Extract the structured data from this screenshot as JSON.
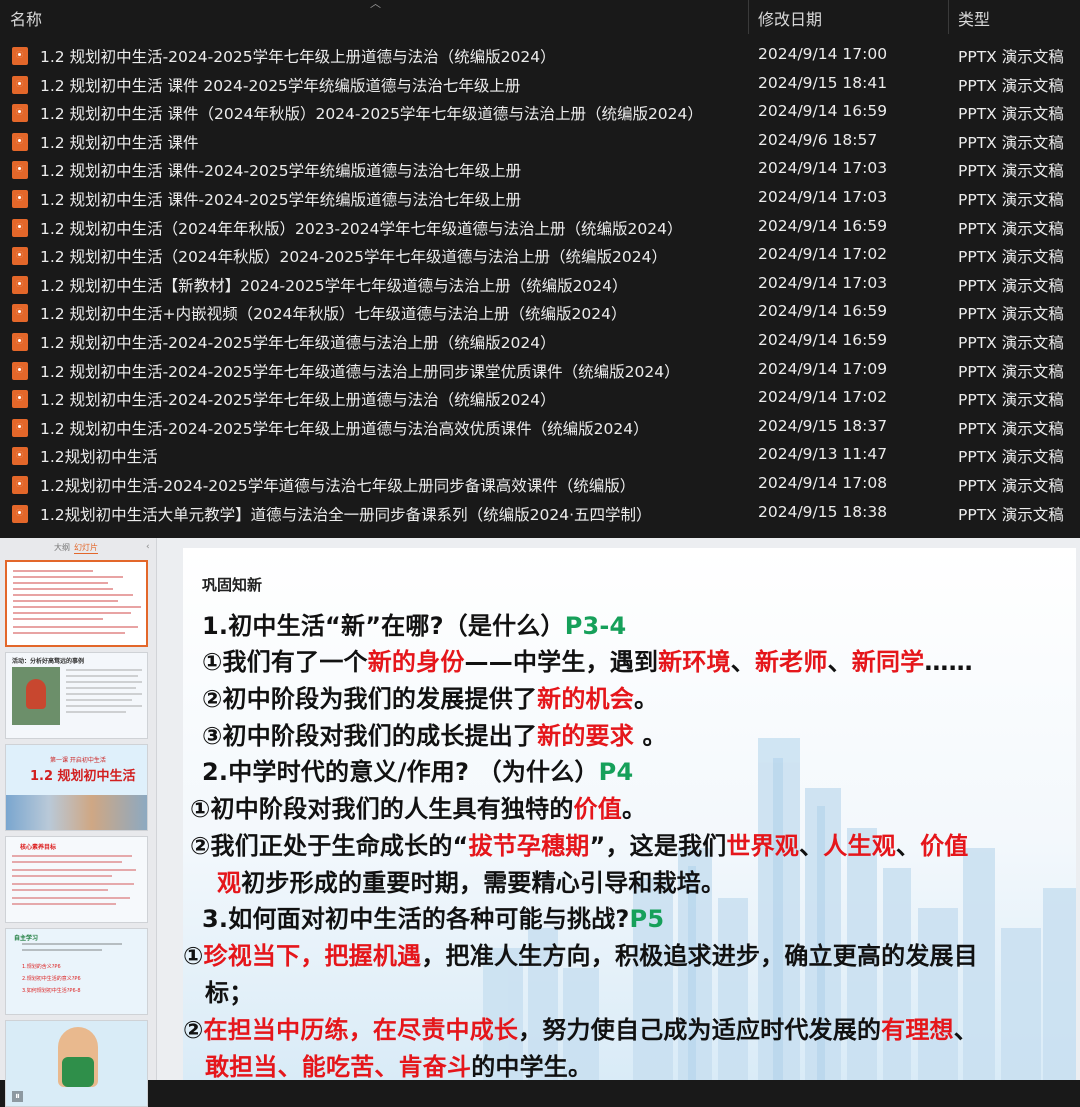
{
  "explorer": {
    "columns": {
      "name": "名称",
      "modified": "修改日期",
      "type": "类型"
    },
    "rows": [
      {
        "name": "1.2  规划初中生活-2024-2025学年七年级上册道德与法治（统编版2024）",
        "date": "2024/9/14 17:00",
        "type": "PPTX 演示文稿"
      },
      {
        "name": "1.2 规划初中生活 课件 2024-2025学年统编版道德与法治七年级上册",
        "date": "2024/9/15 18:41",
        "type": "PPTX 演示文稿"
      },
      {
        "name": "1.2 规划初中生活 课件（2024年秋版）2024-2025学年七年级道德与法治上册（统编版2024）",
        "date": "2024/9/14 16:59",
        "type": "PPTX 演示文稿"
      },
      {
        "name": "1.2 规划初中生活 课件",
        "date": "2024/9/6 18:57",
        "type": "PPTX 演示文稿"
      },
      {
        "name": "1.2 规划初中生活 课件-2024-2025学年统编版道德与法治七年级上册",
        "date": "2024/9/14 17:03",
        "type": "PPTX 演示文稿"
      },
      {
        "name": "1.2 规划初中生活 课件-2024-2025学年统编版道德与法治七年级上册",
        "date": "2024/9/14 17:03",
        "type": "PPTX 演示文稿"
      },
      {
        "name": "1.2 规划初中生活（2024年年秋版）2023-2024学年七年级道德与法治上册（统编版2024）",
        "date": "2024/9/14 16:59",
        "type": "PPTX 演示文稿"
      },
      {
        "name": "1.2 规划初中生活（2024年秋版）2024-2025学年七年级道德与法治上册（统编版2024）",
        "date": "2024/9/14 17:02",
        "type": "PPTX 演示文稿"
      },
      {
        "name": "1.2 规划初中生活【新教材】2024-2025学年七年级道德与法治上册（统编版2024）",
        "date": "2024/9/14 17:03",
        "type": "PPTX 演示文稿"
      },
      {
        "name": "1.2 规划初中生活+内嵌视频（2024年秋版）七年级道德与法治上册（统编版2024）",
        "date": "2024/9/14 16:59",
        "type": "PPTX 演示文稿"
      },
      {
        "name": "1.2 规划初中生活-2024-2025学年七年级道德与法治上册（统编版2024）",
        "date": "2024/9/14 16:59",
        "type": "PPTX 演示文稿"
      },
      {
        "name": "1.2 规划初中生活-2024-2025学年七年级道德与法治上册同步课堂优质课件（统编版2024）",
        "date": "2024/9/14 17:09",
        "type": "PPTX 演示文稿"
      },
      {
        "name": "1.2 规划初中生活-2024-2025学年七年级上册道德与法治（统编版2024）",
        "date": "2024/9/14 17:02",
        "type": "PPTX 演示文稿"
      },
      {
        "name": "1.2 规划初中生活-2024-2025学年七年级上册道德与法治高效优质课件（统编版2024）",
        "date": "2024/9/15 18:37",
        "type": "PPTX 演示文稿"
      },
      {
        "name": "1.2规划初中生活",
        "date": "2024/9/13 11:47",
        "type": "PPTX 演示文稿"
      },
      {
        "name": "1.2规划初中生活-2024-2025学年道德与法治七年级上册同步备课高效课件（统编版）",
        "date": "2024/9/14 17:08",
        "type": "PPTX 演示文稿"
      },
      {
        "name": "1.2规划初中生活大单元教学】道德与法治全一册同步备课系列（统编版2024·五四学制）",
        "date": "2024/9/15 18:38",
        "type": "PPTX 演示文稿"
      }
    ]
  },
  "editor": {
    "tabs": {
      "outline": "大纲",
      "slides": "幻灯片"
    },
    "thumbnails": {
      "t2_title": "活动：分析好高骛远的事例",
      "t3_sub": "第一课  开启初中生活",
      "t3_title": "1.2 规划初中生活",
      "t4_title": "核心素养目标",
      "t5_title": "自主学习",
      "t5_items": [
        "1.规划的含义?P6",
        "2.规划初中生活的意义?P6",
        "3.如何规划初中生活?P6-8"
      ]
    }
  },
  "slide": {
    "kicker": "巩固知新",
    "q1": {
      "text": "1.初中生活“新”在哪?（是什么）",
      "page": "P3-4"
    },
    "q1_a1": [
      "①我们有了一个",
      "新的身份",
      "——中学生，遇到",
      "新环境",
      "、",
      "新老师",
      "、",
      "新同学",
      "……"
    ],
    "q1_a2": [
      "②初中阶段为我们的发展提供了",
      "新的机会",
      "。"
    ],
    "q1_a3": [
      "③初中阶段对我们的成长提出了",
      "新的要求",
      " 。"
    ],
    "q2": {
      "text": "2.中学时代的意义/作用? （为什么）",
      "page": "P4"
    },
    "q2_a1": [
      "①初中阶段对我们的人生具有独特的",
      "价值",
      "。"
    ],
    "q2_a2": [
      "②我们正处于生命成长的“",
      "拔节孕穗期",
      "”，这是我们",
      "世界观",
      "、",
      "人生观",
      "、",
      "价值"
    ],
    "q2_a2b": [
      "观",
      "初步形成的重要时期，需要精心引导和栽培。"
    ],
    "q3": {
      "text": "3.如何面对初中生活的各种可能与挑战?",
      "page": "P5"
    },
    "q3_a1": [
      "①",
      "珍视当下，把握机遇",
      "，把准人生方向，积极追求进步，确立更高的发展目"
    ],
    "q3_a1b": "标；",
    "q3_a2": [
      "②",
      "在担当中历练，在尽责中成长",
      "，努力使自己成为适应时代发展的",
      "有理想",
      "、"
    ],
    "q3_a2b": [
      "敢担当、能吃苦、肯奋斗",
      "的中学生。"
    ]
  }
}
